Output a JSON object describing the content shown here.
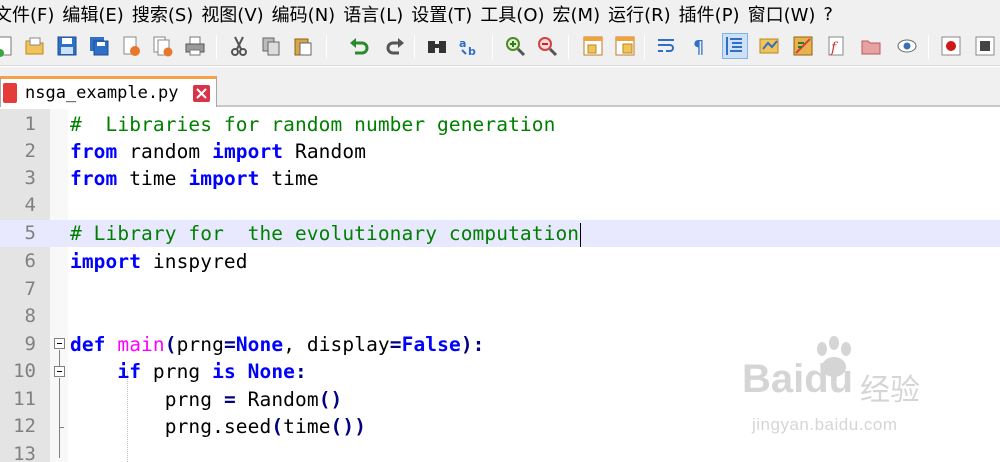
{
  "menu": {
    "items": [
      "文件(F)",
      "编辑(E)",
      "搜索(S)",
      "视图(V)",
      "编码(N)",
      "语言(L)",
      "设置(T)",
      "工具(O)",
      "宏(M)",
      "运行(R)",
      "插件(P)",
      "窗口(W)",
      "?"
    ]
  },
  "toolbar": {
    "buttons": [
      "new-file-icon",
      "open-file-icon",
      "save-icon",
      "save-all-icon",
      "close-icon",
      "close-all-icon",
      "print-icon",
      "cut-icon",
      "copy-icon",
      "paste-icon",
      "undo-icon",
      "redo-icon",
      "find-icon",
      "replace-icon",
      "zoom-in-icon",
      "zoom-out-icon",
      "sync-vertical-icon",
      "sync-horizontal-icon",
      "word-wrap-icon",
      "show-all-chars-icon",
      "indent-guide-icon",
      "udl-icon",
      "doc-map-icon",
      "function-list-icon",
      "folder-workspace-icon",
      "monitoring-icon",
      "record-macro-icon"
    ],
    "active_button": "indent-guide-icon"
  },
  "tabs": [
    {
      "label": "nsga_example.py",
      "active": true
    }
  ],
  "editor": {
    "current_line": 5,
    "lines": [
      {
        "num": "1",
        "text": "#  Libraries for random number generation"
      },
      {
        "num": "2",
        "text": "from random import Random"
      },
      {
        "num": "3",
        "text": "from time import time"
      },
      {
        "num": "4",
        "text": ""
      },
      {
        "num": "5",
        "text": "# Library for  the evolutionary computation"
      },
      {
        "num": "6",
        "text": "import inspyred"
      },
      {
        "num": "7",
        "text": ""
      },
      {
        "num": "8",
        "text": ""
      },
      {
        "num": "9",
        "text": "def main(prng=None, display=False):"
      },
      {
        "num": "10",
        "text": "    if prng is None:"
      },
      {
        "num": "11",
        "text": "        prng = Random()"
      },
      {
        "num": "12",
        "text": "        prng.seed(time())"
      },
      {
        "num": "13",
        "text": ""
      }
    ]
  },
  "watermark": {
    "brand": "Baidu",
    "brand_cn": "经验",
    "url": "jingyan.baidu.com"
  },
  "colors": {
    "keyword": "#0000ff",
    "comment": "#008000",
    "function_name": "#ff00ff",
    "current_line": "#e8e8ff",
    "tab_accent": "#f7a04a"
  }
}
